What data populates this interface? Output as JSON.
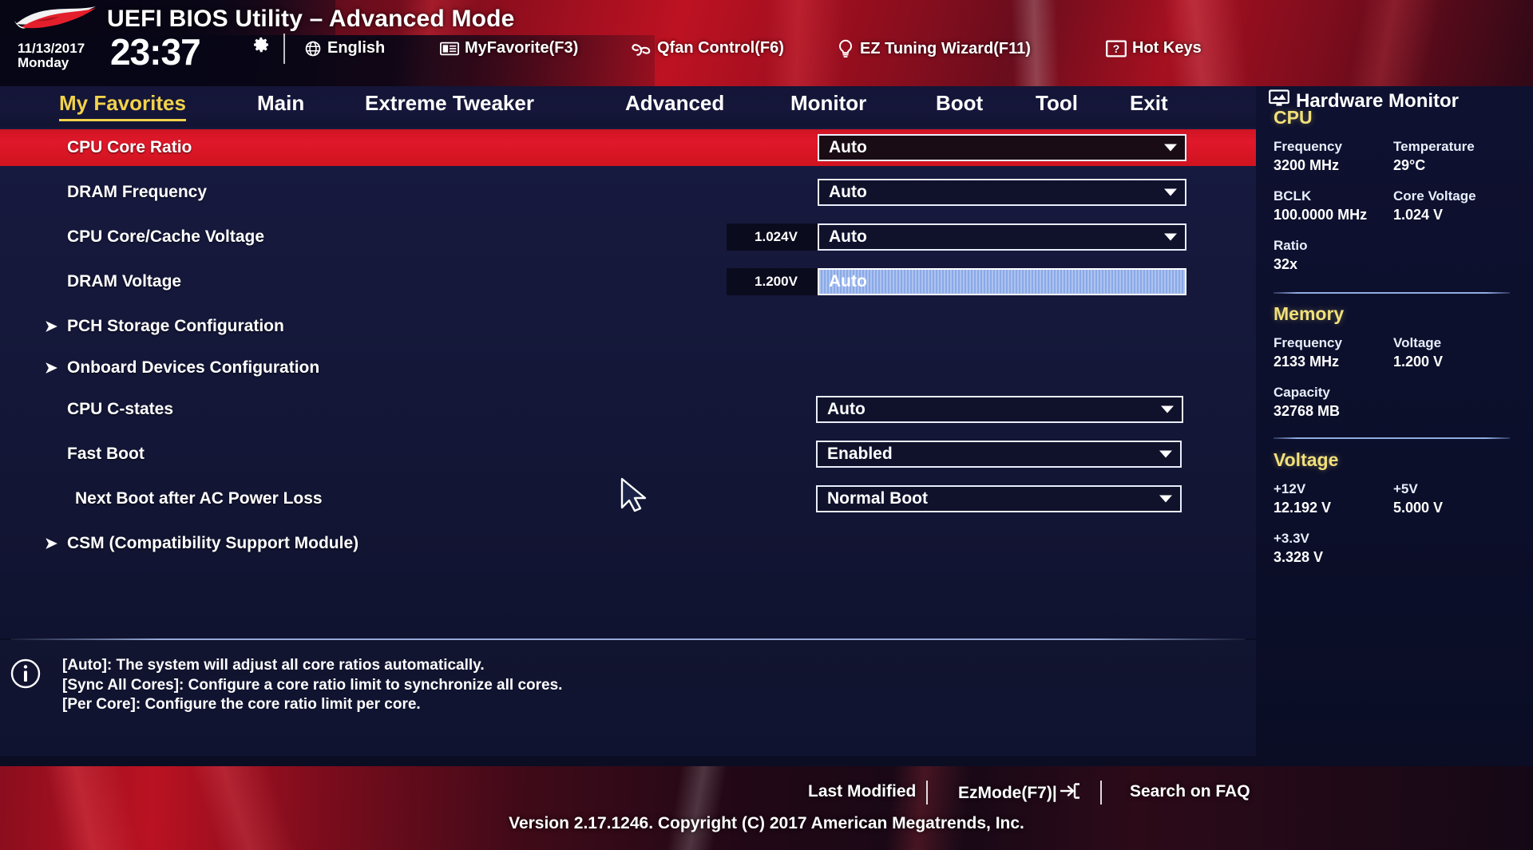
{
  "header": {
    "app_title": "UEFI BIOS Utility – Advanced Mode",
    "date": "11/13/2017",
    "weekday": "Monday",
    "time": "23:37",
    "gear_icon": "gear-icon",
    "items": [
      {
        "label": "English",
        "icon": "globe-icon"
      },
      {
        "label": "MyFavorite(F3)",
        "icon": "favorite-card-icon"
      },
      {
        "label": "Qfan Control(F6)",
        "icon": "fan-icon"
      },
      {
        "label": "EZ Tuning Wizard(F11)",
        "icon": "lightbulb-icon"
      },
      {
        "label": "Hot Keys",
        "icon": "question-box-icon"
      }
    ]
  },
  "tabs": [
    {
      "label": "My Favorites",
      "active": true
    },
    {
      "label": "Main",
      "active": false
    },
    {
      "label": "Extreme Tweaker",
      "active": false
    },
    {
      "label": "Advanced",
      "active": false
    },
    {
      "label": "Monitor",
      "active": false
    },
    {
      "label": "Boot",
      "active": false
    },
    {
      "label": "Tool",
      "active": false
    },
    {
      "label": "Exit",
      "active": false
    }
  ],
  "rows": [
    {
      "label": "CPU Core Ratio",
      "type": "combo",
      "value": "Auto",
      "selected": true,
      "focused": false,
      "tag": "",
      "indent": 0
    },
    {
      "label": "DRAM Frequency",
      "type": "combo",
      "value": "Auto",
      "selected": false,
      "focused": false,
      "tag": "",
      "indent": 0
    },
    {
      "label": "CPU Core/Cache Voltage",
      "type": "combo",
      "value": "Auto",
      "selected": false,
      "focused": false,
      "tag": "1.024V",
      "indent": 0
    },
    {
      "label": "DRAM Voltage",
      "type": "combo",
      "value": "Auto",
      "selected": false,
      "focused": true,
      "tag": "1.200V",
      "indent": 0
    },
    {
      "label": "PCH Storage Configuration",
      "type": "submenu",
      "value": "",
      "selected": false,
      "focused": false,
      "tag": "",
      "indent": 0
    },
    {
      "label": "Onboard Devices Configuration",
      "type": "submenu",
      "value": "",
      "selected": false,
      "focused": false,
      "tag": "",
      "indent": 0
    },
    {
      "label": "CPU C-states",
      "type": "combo",
      "value": "Auto",
      "selected": false,
      "focused": false,
      "tag": "",
      "indent": 0
    },
    {
      "label": "Fast Boot",
      "type": "combo",
      "value": "Enabled",
      "selected": false,
      "focused": false,
      "tag": "",
      "indent": 0
    },
    {
      "label": "Next Boot after AC Power Loss",
      "type": "combo",
      "value": "Normal Boot",
      "selected": false,
      "focused": false,
      "tag": "",
      "indent": 1
    },
    {
      "label": "CSM (Compatibility Support Module)",
      "type": "submenu",
      "value": "",
      "selected": false,
      "focused": false,
      "tag": "",
      "indent": 0
    }
  ],
  "help": {
    "icon": "info-icon",
    "line1": "[Auto]: The system will adjust all core ratios automatically.",
    "line2": "[Sync All Cores]: Configure a core ratio limit to synchronize all cores.",
    "line3": "[Per Core]: Configure the core ratio limit per core."
  },
  "hardware_monitor": {
    "title": "Hardware Monitor",
    "title_icon": "monitor-icon",
    "sections": [
      {
        "name": "CPU",
        "pairs": [
          {
            "label": "Frequency",
            "value": "3200 MHz"
          },
          {
            "label": "Temperature",
            "value": "29°C"
          },
          {
            "label": "BCLK",
            "value": "100.0000 MHz"
          },
          {
            "label": "Core Voltage",
            "value": "1.024 V"
          },
          {
            "label": "Ratio",
            "value": "32x"
          }
        ]
      },
      {
        "name": "Memory",
        "pairs": [
          {
            "label": "Frequency",
            "value": "2133 MHz"
          },
          {
            "label": "Voltage",
            "value": "1.200 V"
          },
          {
            "label": "Capacity",
            "value": "32768 MB"
          }
        ]
      },
      {
        "name": "Voltage",
        "pairs": [
          {
            "label": "+12V",
            "value": "12.192 V"
          },
          {
            "label": "+5V",
            "value": "5.000 V"
          },
          {
            "label": "+3.3V",
            "value": "3.328 V"
          }
        ]
      }
    ]
  },
  "footer": {
    "last_modified": "Last Modified",
    "ez_mode": "EzMode(F7)|",
    "ez_mode_icon": "arrow-into-box-icon",
    "search_faq": "Search on FAQ",
    "version": "Version 2.17.1246. Copyright (C) 2017 American Megatrends, Inc."
  },
  "colors": {
    "accent_red": "#d7162a",
    "accent_yellow": "#f2d24a",
    "panel_blue": "#141738",
    "focus_blue": "#8aa9e8"
  }
}
